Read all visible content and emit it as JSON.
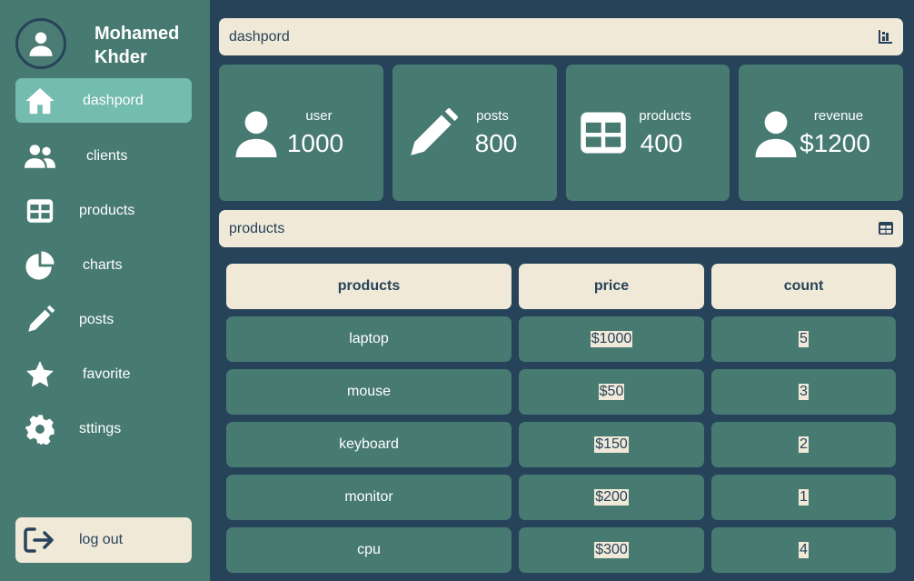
{
  "profile": {
    "name": "Mohamed Khder",
    "avatar_icon": "user-circle-icon"
  },
  "sidebar": {
    "items": [
      {
        "label": "dashpord",
        "icon": "home-icon",
        "active": true
      },
      {
        "label": "clients",
        "icon": "users-icon"
      },
      {
        "label": "products",
        "icon": "table-icon"
      },
      {
        "label": "charts",
        "icon": "pie-chart-icon"
      },
      {
        "label": "posts",
        "icon": "pencil-icon"
      },
      {
        "label": "favorite",
        "icon": "star-icon"
      },
      {
        "label": "sttings",
        "icon": "gear-icon"
      }
    ],
    "logout_label": "log out"
  },
  "header": {
    "title": "dashpord",
    "icon": "bar-chart-icon"
  },
  "stats": [
    {
      "label": "user",
      "value": "1000",
      "icon": "user-icon"
    },
    {
      "label": "posts",
      "value": "800",
      "icon": "pencil-icon"
    },
    {
      "label": "products",
      "value": "400",
      "icon": "table-icon"
    },
    {
      "label": "revenue",
      "value": "$1200",
      "icon": "user-icon"
    }
  ],
  "products_section": {
    "title": "products",
    "icon": "table-icon"
  },
  "table": {
    "columns": [
      "products",
      "price",
      "count"
    ],
    "rows": [
      [
        "laptop",
        "$1000",
        "5"
      ],
      [
        "mouse",
        "$50",
        "3"
      ],
      [
        "keyboard",
        "$150",
        "2"
      ],
      [
        "monitor",
        "$200",
        "1"
      ],
      [
        "cpu",
        "$300",
        "4"
      ]
    ]
  },
  "colors": {
    "background": "#27435a",
    "panel": "#477a71",
    "active": "#74bbb0",
    "cream": "#f0e9d8"
  }
}
